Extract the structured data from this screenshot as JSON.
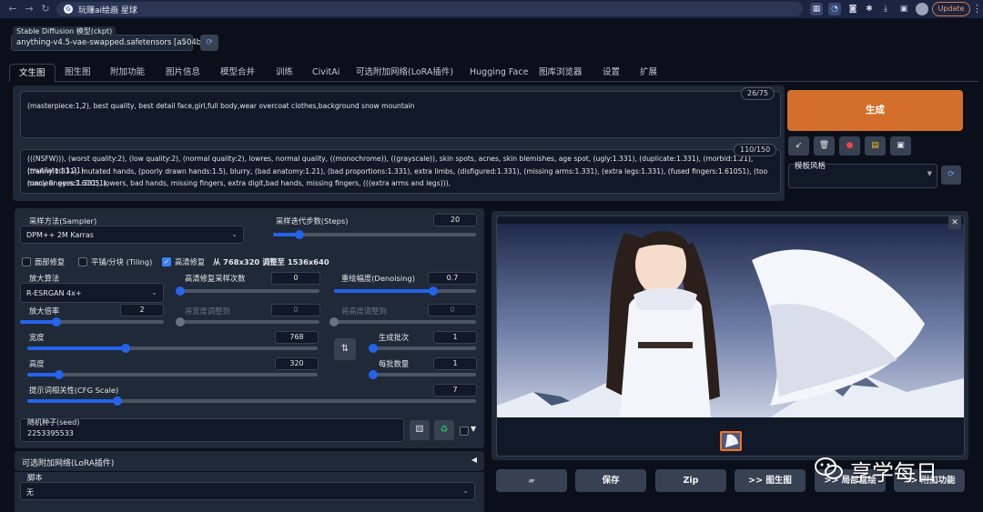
{
  "browser": {
    "url_text": "玩赚ai绘画 星球",
    "update_label": "Update",
    "extension_icons": [
      "puzzle-icon",
      "colorful-icon",
      "camera-icon",
      "extensions-icon",
      "download-icon",
      "sidebar-icon"
    ]
  },
  "model": {
    "label": "Stable Diffusion 模型(ckpt)",
    "value": "anything-v4.5-vae-swapped.safetensors [a504b5"
  },
  "tabs": [
    "文生图",
    "图生图",
    "附加功能",
    "图片信息",
    "模型合并",
    "训练",
    "CivitAi",
    "可选附加网络(LoRA插件)",
    "Hugging Face",
    "图库浏览器",
    "设置",
    "扩展"
  ],
  "prompt": {
    "positive": "(masterpiece:1,2), best quality, best detail face,girl,full body,wear overcoat clothes,background snow mountain",
    "positive_count": "26/75",
    "negative_lines": [
      "(((NSFW))), (worst quality:2), (low quality:2), (normal quality:2), lowres, normal quality, ((monochrome)), ((grayscale)), skin spots, acnes, skin blemishes, age spot, (ugly:1.331), (duplicate:1.331), (morbid:1.21), (mutilated:1.21),",
      "(tranny:1.331), mutated hands, (poorly drawn hands:1.5), blurry, (bad anatomy:1.21), (bad proportions:1.331), extra limbs, (disfigured:1.331), (missing arms:1.331), (extra legs:1.331), (fused fingers:1.61051), (too many fingers:1.61051),",
      "(unclear eyes:1.331), lowers, bad hands, missing fingers, extra digit,bad hands, missing fingers, (((extra arms and legs))),"
    ],
    "negative_count": "110/150"
  },
  "actions": {
    "generate": "生成",
    "style_label": "模板风格"
  },
  "settings": {
    "sampler_label": "采样方法(Sampler)",
    "sampler_value": "DPM++ 2M Karras",
    "steps_label": "采样迭代步数(Steps)",
    "steps_value": "20",
    "steps_fraction": 0.13,
    "face_restore": "面部修复",
    "tiling": "平铺/分块 (Tiling)",
    "hires": "高清修复",
    "hires_info": "从 768x320 调整至 1536x640",
    "upscaler_label": "放大算法",
    "upscaler_value": "R-ESRGAN 4x+",
    "hires_steps_label": "高清修复采样次数",
    "hires_steps_value": "0",
    "hires_steps_fraction": 0.0,
    "denoise_label": "重绘幅度(Denoising)",
    "denoise_value": "0.7",
    "denoise_fraction": 0.7,
    "upscale_by_label": "放大倍率",
    "upscale_by_value": "2",
    "upscale_by_fraction": 0.25,
    "resize_w_label": "将宽度调整到",
    "resize_w_value": "0",
    "resize_h_label": "将高度调整到",
    "resize_h_value": "0",
    "width_label": "宽度",
    "width_value": "768",
    "width_fraction": 0.34,
    "height_label": "高度",
    "height_value": "320",
    "height_fraction": 0.11,
    "batch_count_label": "生成批次",
    "batch_count_value": "1",
    "batch_count_fraction": 0.0,
    "batch_size_label": "每批数量",
    "batch_size_value": "1",
    "batch_size_fraction": 0.0,
    "cfg_label": "提示词相关性(CFG Scale)",
    "cfg_value": "7",
    "cfg_fraction": 0.2,
    "seed_label": "随机种子(seed)",
    "seed_value": "2253395533"
  },
  "lora": {
    "label": "可选附加网络(LoRA插件)"
  },
  "script": {
    "label": "脚本",
    "value": "无"
  },
  "output_buttons": [
    "保存",
    "Zip",
    ">> 图生图",
    ">> 局部重绘",
    ">> 附加功能"
  ],
  "watermark": "享学每日",
  "colors": {
    "generate": "#d36f2a",
    "accent": "#2563eb",
    "background": "#0b0f19"
  }
}
